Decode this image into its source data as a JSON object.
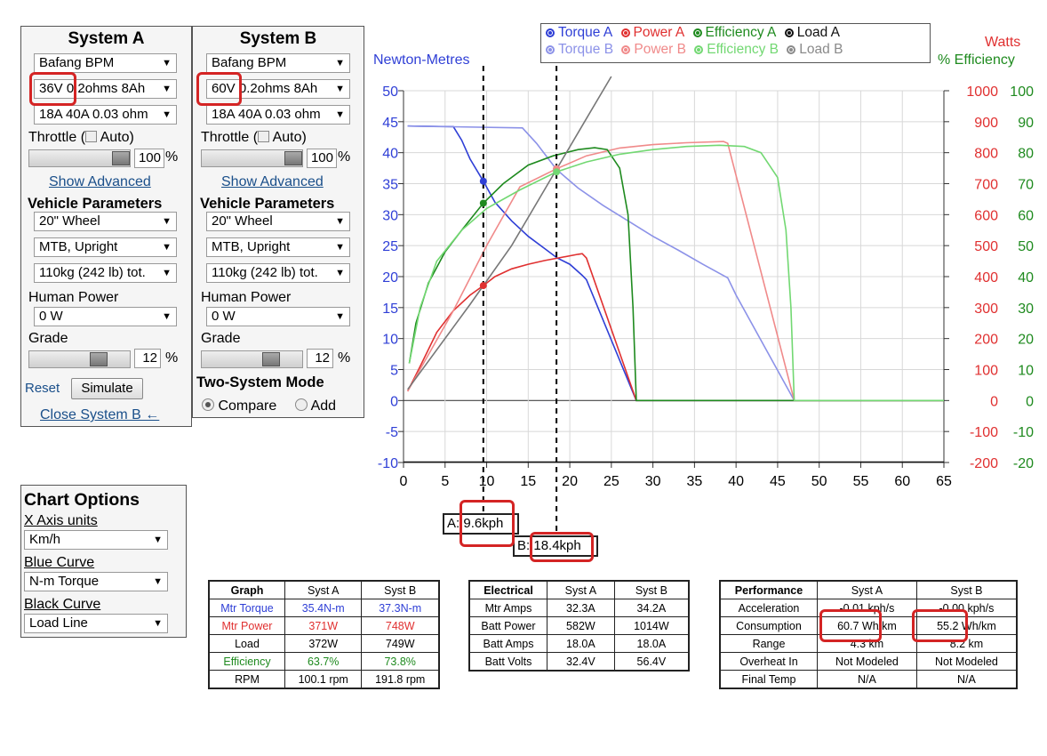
{
  "systemA": {
    "title": "System A",
    "motor": "Bafang BPM",
    "battery_voltage": "36V",
    "battery_rest": "0.2ohms 8Ah",
    "controller": "18A 40A 0.03 ohm",
    "throttle_label": "Throttle (",
    "auto_label": "Auto)",
    "throttle_value": "100",
    "throttle_unit": "%",
    "show_advanced": "Show Advanced",
    "vehicle_params": "Vehicle Parameters",
    "wheel": "20\"  Wheel",
    "bike": "MTB, Upright",
    "weight": "110kg (242 lb) tot.",
    "human_power_label": "Human Power",
    "human_power": "0 W",
    "grade_label": "Grade",
    "grade_value": "12",
    "grade_unit": "%",
    "reset": "Reset",
    "simulate": "Simulate",
    "close": "Close System B ←"
  },
  "systemB": {
    "title": "System B",
    "motor": "Bafang BPM",
    "battery_voltage": "60V",
    "battery_rest": "0.2ohms 8Ah",
    "controller": "18A 40A 0.03 ohm",
    "throttle_label": "Throttle (",
    "auto_label": "Auto)",
    "throttle_value": "100",
    "throttle_unit": "%",
    "show_advanced": "Show Advanced",
    "vehicle_params": "Vehicle Parameters",
    "wheel": "20\"  Wheel",
    "bike": "MTB, Upright",
    "weight": "110kg (242 lb) tot.",
    "human_power_label": "Human Power",
    "human_power": "0 W",
    "grade_label": "Grade",
    "grade_value": "12",
    "grade_unit": "%",
    "two_system_mode": "Two-System Mode",
    "compare": "Compare",
    "add": "Add"
  },
  "chart_options": {
    "title": "Chart Options",
    "x_axis_label": "X Axis units",
    "x_axis_value": "Km/h",
    "blue_label": "Blue Curve",
    "blue_value": "N-m Torque",
    "black_label": "Black Curve",
    "black_value": "Load Line"
  },
  "legend": {
    "row1": [
      {
        "label": "Torque A",
        "color": "#2f3fd6"
      },
      {
        "label": "Power A",
        "color": "#e03030"
      },
      {
        "label": "Efficiency A",
        "color": "#1e8a1e"
      },
      {
        "label": "Load A",
        "color": "#111111"
      }
    ],
    "row2": [
      {
        "label": "Torque B",
        "color": "#8c92e8"
      },
      {
        "label": "Power B",
        "color": "#f08a8a"
      },
      {
        "label": "Efficiency B",
        "color": "#72d872"
      },
      {
        "label": "Load B",
        "color": "#8a8a8a"
      }
    ]
  },
  "markers": {
    "a_label": "A:",
    "a_value": "9.6kph",
    "b_label": "B:",
    "b_value": "18.4kph"
  },
  "chart_data": {
    "type": "line",
    "y_left_label": "Newton-Metres",
    "y_right_label_1": "Watts",
    "y_right_label_2": "% Efficiency",
    "x_ticks": [
      0,
      5,
      10,
      15,
      20,
      25,
      30,
      35,
      40,
      45,
      50,
      55,
      60,
      65
    ],
    "y_left_ticks": [
      50,
      45,
      40,
      35,
      30,
      25,
      20,
      15,
      10,
      5,
      0,
      -5,
      -10
    ],
    "watts_ticks": [
      1000,
      900,
      800,
      700,
      600,
      500,
      400,
      300,
      200,
      100,
      0,
      -100,
      -200
    ],
    "eff_ticks": [
      100,
      90,
      80,
      70,
      60,
      50,
      40,
      30,
      20,
      10,
      0,
      -10,
      -20
    ],
    "xlim": [
      0,
      65
    ],
    "ylim": [
      -10,
      50
    ],
    "marker_x": [
      9.6,
      18.4
    ],
    "series": [
      {
        "name": "Torque A",
        "color": "#2f3fd6",
        "axis": "nm",
        "points": [
          [
            0.5,
            44.3
          ],
          [
            6,
            44.2
          ],
          [
            7,
            42
          ],
          [
            8,
            39
          ],
          [
            9.6,
            35.4
          ],
          [
            11,
            32
          ],
          [
            13,
            29
          ],
          [
            15,
            26.5
          ],
          [
            17,
            24.5
          ],
          [
            18.5,
            23
          ],
          [
            20,
            22
          ],
          [
            21.5,
            20.2
          ],
          [
            22,
            19.5
          ],
          [
            28,
            0
          ],
          [
            47,
            0
          ],
          [
            65,
            0
          ]
        ]
      },
      {
        "name": "Torque B",
        "color": "#8c92e8",
        "axis": "nm",
        "points": [
          [
            0.5,
            44.3
          ],
          [
            14.3,
            44.0
          ],
          [
            16,
            41.5
          ],
          [
            18.4,
            37.3
          ],
          [
            21,
            34.3
          ],
          [
            24,
            31.5
          ],
          [
            27,
            29
          ],
          [
            30,
            26.5
          ],
          [
            33,
            24.3
          ],
          [
            36,
            22
          ],
          [
            39,
            19.8
          ],
          [
            40,
            17
          ],
          [
            47,
            0
          ],
          [
            65,
            0
          ]
        ]
      },
      {
        "name": "Power A",
        "color": "#e03030",
        "axis": "w",
        "points": [
          [
            0.5,
            30
          ],
          [
            2,
            110
          ],
          [
            4,
            220
          ],
          [
            6,
            290
          ],
          [
            8,
            340
          ],
          [
            9.6,
            371
          ],
          [
            11,
            400
          ],
          [
            13,
            425
          ],
          [
            15,
            440
          ],
          [
            17,
            452
          ],
          [
            19,
            462
          ],
          [
            21,
            472
          ],
          [
            21.5,
            474
          ],
          [
            22,
            460
          ],
          [
            28,
            0
          ],
          [
            65,
            0
          ]
        ]
      },
      {
        "name": "Power B",
        "color": "#f08a8a",
        "axis": "w",
        "points": [
          [
            0.5,
            30
          ],
          [
            6,
            290
          ],
          [
            10,
            500
          ],
          [
            14,
            690
          ],
          [
            18.4,
            748
          ],
          [
            22,
            790
          ],
          [
            26,
            815
          ],
          [
            30,
            826
          ],
          [
            34,
            832
          ],
          [
            38.5,
            836
          ],
          [
            39,
            830
          ],
          [
            47,
            0
          ],
          [
            65,
            0
          ]
        ]
      },
      {
        "name": "Efficiency A",
        "color": "#1e8a1e",
        "axis": "pct",
        "points": [
          [
            0.7,
            12
          ],
          [
            1.5,
            25
          ],
          [
            3,
            38
          ],
          [
            5,
            48
          ],
          [
            7,
            55
          ],
          [
            9.6,
            63.7
          ],
          [
            12,
            70
          ],
          [
            15,
            76
          ],
          [
            18,
            79
          ],
          [
            21,
            81
          ],
          [
            23,
            81.6
          ],
          [
            24.5,
            81
          ],
          [
            26,
            75
          ],
          [
            27,
            60
          ],
          [
            27.6,
            30
          ],
          [
            28,
            0
          ],
          [
            65,
            0
          ]
        ]
      },
      {
        "name": "Efficiency B",
        "color": "#72d872",
        "axis": "pct",
        "points": [
          [
            0.7,
            12
          ],
          [
            2,
            30
          ],
          [
            4,
            45
          ],
          [
            7,
            55
          ],
          [
            10,
            62
          ],
          [
            14,
            68
          ],
          [
            18.4,
            73.8
          ],
          [
            22,
            77
          ],
          [
            26,
            79.5
          ],
          [
            30,
            81
          ],
          [
            34,
            82
          ],
          [
            38,
            82.4
          ],
          [
            41,
            82
          ],
          [
            43,
            80
          ],
          [
            45,
            72
          ],
          [
            46,
            55
          ],
          [
            46.6,
            30
          ],
          [
            47,
            0
          ],
          [
            65,
            0
          ]
        ]
      },
      {
        "name": "Load A",
        "color": "#111111",
        "axis": "nm",
        "points": [
          [
            0,
            -10
          ],
          [
            65,
            -10
          ]
        ]
      },
      {
        "name": "Load B",
        "color": "#777777",
        "axis": "nm",
        "points": [
          [
            0.5,
            1.8
          ],
          [
            8,
            15.5
          ],
          [
            13,
            25
          ],
          [
            18.4,
            37.3
          ],
          [
            22,
            45.5
          ],
          [
            25,
            52.3
          ]
        ]
      }
    ],
    "point_markers": [
      {
        "series": "Torque A",
        "x": 9.6,
        "y": 35.4,
        "axis": "nm",
        "color": "#2f3fd6"
      },
      {
        "series": "Efficiency A",
        "x": 9.6,
        "y": 63.7,
        "axis": "pct",
        "color": "#1e8a1e"
      },
      {
        "series": "Power A",
        "x": 9.6,
        "y": 371,
        "axis": "w",
        "color": "#e03030"
      },
      {
        "series": "Torque B",
        "x": 18.4,
        "y": 37.3,
        "axis": "nm",
        "color": "#8c92e8"
      },
      {
        "series": "Power B",
        "x": 18.4,
        "y": 748,
        "axis": "w",
        "color": "#f08a8a"
      },
      {
        "series": "Efficiency B",
        "x": 18.4,
        "y": 73.8,
        "axis": "pct",
        "color": "#72d872"
      }
    ]
  },
  "graph_table": {
    "headers": [
      "Graph",
      "Syst A",
      "Syst B"
    ],
    "rows": [
      {
        "label": "Mtr Torque",
        "a": "35.4N-m",
        "b": "37.3N-m",
        "color": "#2f3fd6"
      },
      {
        "label": "Mtr Power",
        "a": "371W",
        "b": "748W",
        "color": "#e03030"
      },
      {
        "label": "Load",
        "a": "372W",
        "b": "749W",
        "color": "#000000"
      },
      {
        "label": "Efficiency",
        "a": "63.7%",
        "b": "73.8%",
        "color": "#1e8a1e"
      },
      {
        "label": "RPM",
        "a": "100.1 rpm",
        "b": "191.8 rpm",
        "color": "#000000"
      }
    ]
  },
  "electrical_table": {
    "headers": [
      "Electrical",
      "Syst A",
      "Syst B"
    ],
    "rows": [
      {
        "label": "Mtr Amps",
        "a": "32.3A",
        "b": "34.2A"
      },
      {
        "label": "Batt Power",
        "a": "582W",
        "b": "1014W"
      },
      {
        "label": "Batt Amps",
        "a": "18.0A",
        "b": "18.0A"
      },
      {
        "label": "Batt Volts",
        "a": "32.4V",
        "b": "56.4V"
      }
    ]
  },
  "performance_table": {
    "headers": [
      "Performance",
      "Syst A",
      "Syst B"
    ],
    "rows": [
      {
        "label": "Acceleration",
        "a": "-0.01 kph/s",
        "b": "-0.00 kph/s"
      },
      {
        "label": "Consumption",
        "a": "60.7 Wh/km",
        "b": "55.2 Wh/km"
      },
      {
        "label": "Range",
        "a": "4.3 km",
        "b": "8.2 km"
      },
      {
        "label": "Overheat In",
        "a": "Not Modeled",
        "b": "Not Modeled"
      },
      {
        "label": "Final Temp",
        "a": "N/A",
        "b": "N/A"
      }
    ]
  }
}
